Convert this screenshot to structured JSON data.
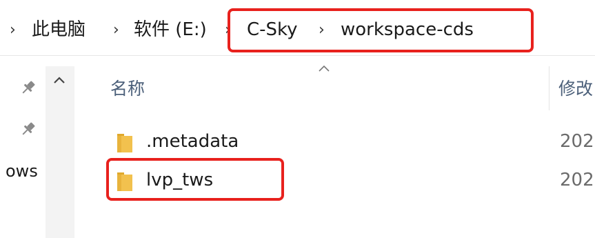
{
  "breadcrumb": {
    "items": [
      "此电脑",
      "软件 (E:)",
      "C-Sky",
      "workspace-cds"
    ],
    "separator": "›"
  },
  "nav": {
    "scroll_up_icon": "chevron-up-icon",
    "pin_icon": "pin-icon",
    "partial_label": "ows"
  },
  "columns": {
    "name_label": "名称",
    "modified_label": "修改"
  },
  "files": [
    {
      "name": ".metadata",
      "type": "folder",
      "date_partial": "202"
    },
    {
      "name": "lvp_tws",
      "type": "folder",
      "date_partial": "202"
    }
  ],
  "colors": {
    "highlight": "#e8211d",
    "folder": "#f2c14e",
    "header_text": "#4c607a"
  }
}
